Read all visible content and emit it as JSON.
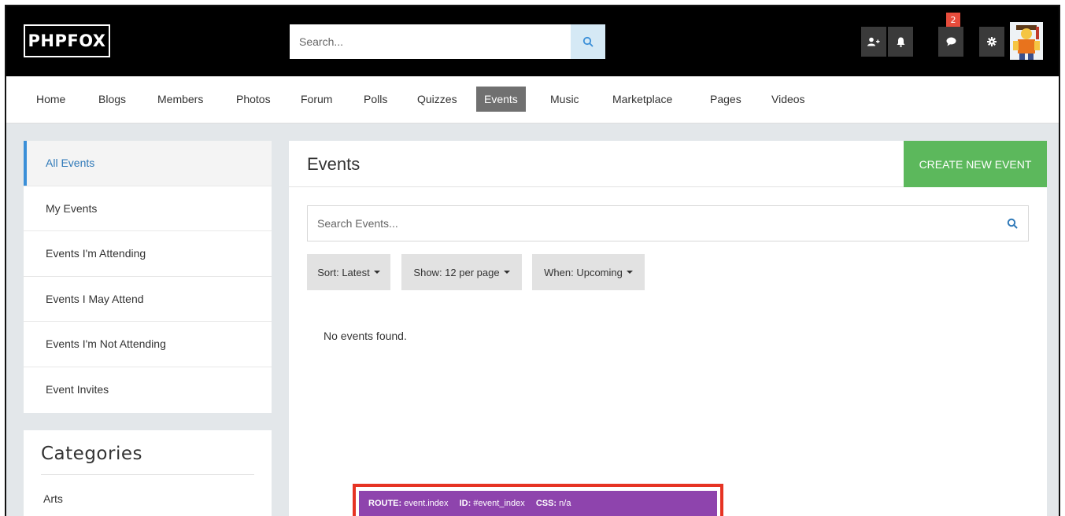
{
  "header": {
    "logo": "PHPFOX",
    "search_placeholder": "Search...",
    "message_badge": "2",
    "icons": [
      "add-friend-icon",
      "bell-icon",
      "chat-bubble-icon",
      "gear-icon"
    ]
  },
  "nav": {
    "items": [
      {
        "label": "Home"
      },
      {
        "label": "Blogs"
      },
      {
        "label": "Members"
      },
      {
        "label": "Photos"
      },
      {
        "label": "Forum"
      },
      {
        "label": "Polls"
      },
      {
        "label": "Quizzes"
      },
      {
        "label": "Events"
      },
      {
        "label": "Music"
      },
      {
        "label": "Marketplace"
      },
      {
        "label": "Pages"
      },
      {
        "label": "Videos"
      }
    ],
    "active": "Events"
  },
  "sidebar": {
    "items": [
      {
        "label": "All Events"
      },
      {
        "label": "My Events"
      },
      {
        "label": "Events I'm Attending"
      },
      {
        "label": "Events I May Attend"
      },
      {
        "label": "Events I'm Not Attending"
      },
      {
        "label": "Event Invites"
      }
    ],
    "categories_title": "Categories",
    "categories": [
      {
        "label": "Arts"
      }
    ]
  },
  "main": {
    "title": "Events",
    "create_button": "CREATE NEW EVENT",
    "search_placeholder": "Search Events...",
    "filters": [
      {
        "label": "Sort: Latest"
      },
      {
        "label": "Show: 12 per page"
      },
      {
        "label": "When: Upcoming"
      }
    ],
    "empty_message": "No events found."
  },
  "debug": {
    "route_label": "ROUTE:",
    "route_value": "event.index",
    "id_label": "ID:",
    "id_value": "#event_index",
    "css_label": "CSS:",
    "css_value": "n/a"
  },
  "colors": {
    "accent_blue": "#3a8fd8",
    "create_green": "#5cb85c",
    "badge_red": "#e74c3c",
    "debug_purple": "#8e44ad",
    "highlight_red": "#e63323"
  }
}
